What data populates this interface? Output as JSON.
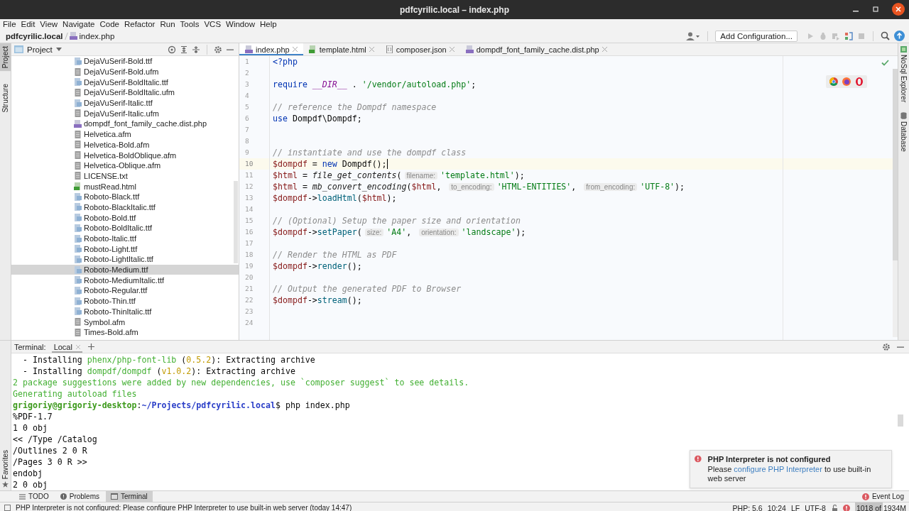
{
  "window": {
    "title": "pdfcyrilic.local – index.php"
  },
  "menu": [
    "File",
    "Edit",
    "View",
    "Navigate",
    "Code",
    "Refactor",
    "Run",
    "Tools",
    "VCS",
    "Window",
    "Help"
  ],
  "breadcrumb": [
    {
      "label": "pdfcyrilic.local",
      "kind": "project"
    },
    {
      "label": "index.php",
      "kind": "php"
    }
  ],
  "toolbar": {
    "run_config": "Add Configuration..."
  },
  "left_tool_tabs": [
    {
      "label": "Project",
      "selected": true
    },
    {
      "label": "Structure",
      "selected": false
    }
  ],
  "favorites": "Favorites",
  "right_tool_tabs": [
    {
      "label": "NoSql Explorer",
      "kind": "nosql"
    },
    {
      "label": "Database",
      "kind": "database"
    }
  ],
  "project_panel": {
    "title": "Project",
    "items": [
      {
        "name": "DejaVuSerif-Bold.ttf",
        "kind": "font",
        "selected": false
      },
      {
        "name": "DejaVuSerif-Bold.ufm",
        "kind": "doc",
        "selected": false
      },
      {
        "name": "DejaVuSerif-BoldItalic.ttf",
        "kind": "font",
        "selected": false
      },
      {
        "name": "DejaVuSerif-BoldItalic.ufm",
        "kind": "doc",
        "selected": false
      },
      {
        "name": "DejaVuSerif-Italic.ttf",
        "kind": "font",
        "selected": false
      },
      {
        "name": "DejaVuSerif-Italic.ufm",
        "kind": "doc",
        "selected": false
      },
      {
        "name": "dompdf_font_family_cache.dist.php",
        "kind": "php",
        "selected": false
      },
      {
        "name": "Helvetica.afm",
        "kind": "doc",
        "selected": false
      },
      {
        "name": "Helvetica-Bold.afm",
        "kind": "doc",
        "selected": false
      },
      {
        "name": "Helvetica-BoldOblique.afm",
        "kind": "doc",
        "selected": false
      },
      {
        "name": "Helvetica-Oblique.afm",
        "kind": "doc",
        "selected": false
      },
      {
        "name": "LICENSE.txt",
        "kind": "doc",
        "selected": false
      },
      {
        "name": "mustRead.html",
        "kind": "html",
        "selected": false
      },
      {
        "name": "Roboto-Black.ttf",
        "kind": "font",
        "selected": false
      },
      {
        "name": "Roboto-BlackItalic.ttf",
        "kind": "font",
        "selected": false
      },
      {
        "name": "Roboto-Bold.ttf",
        "kind": "font",
        "selected": false
      },
      {
        "name": "Roboto-BoldItalic.ttf",
        "kind": "font",
        "selected": false
      },
      {
        "name": "Roboto-Italic.ttf",
        "kind": "font",
        "selected": false
      },
      {
        "name": "Roboto-Light.ttf",
        "kind": "font",
        "selected": false
      },
      {
        "name": "Roboto-LightItalic.ttf",
        "kind": "font",
        "selected": false
      },
      {
        "name": "Roboto-Medium.ttf",
        "kind": "font",
        "selected": true
      },
      {
        "name": "Roboto-MediumItalic.ttf",
        "kind": "font",
        "selected": false
      },
      {
        "name": "Roboto-Regular.ttf",
        "kind": "font",
        "selected": false
      },
      {
        "name": "Roboto-Thin.ttf",
        "kind": "font",
        "selected": false
      },
      {
        "name": "Roboto-ThinItalic.ttf",
        "kind": "font",
        "selected": false
      },
      {
        "name": "Symbol.afm",
        "kind": "doc",
        "selected": false
      },
      {
        "name": "Times-Bold.afm",
        "kind": "doc",
        "selected": false
      }
    ]
  },
  "editor": {
    "tabs": [
      {
        "label": "index.php",
        "kind": "php",
        "selected": true
      },
      {
        "label": "template.html",
        "kind": "html",
        "selected": false
      },
      {
        "label": "composer.json",
        "kind": "json",
        "selected": false
      },
      {
        "label": "dompdf_font_family_cache.dist.php",
        "kind": "php",
        "selected": false
      }
    ],
    "lines": [
      {
        "number": "1",
        "current": false,
        "tokens": [
          {
            "kind": "keyword",
            "text": "<?php"
          }
        ]
      },
      {
        "number": "2",
        "current": false
      },
      {
        "number": "3",
        "current": false,
        "tokens": [
          {
            "kind": "keyword",
            "text": "require "
          },
          {
            "kind": "const",
            "text": "__DIR__"
          },
          {
            "kind": "plain",
            "text": " . "
          },
          {
            "kind": "string",
            "text": "'/vendor/autoload.php'"
          },
          {
            "kind": "plain",
            "text": ";"
          }
        ]
      },
      {
        "number": "4",
        "current": false
      },
      {
        "number": "5",
        "current": false,
        "tokens": [
          {
            "kind": "comment",
            "text": "// reference the Dompdf namespace"
          }
        ]
      },
      {
        "number": "6",
        "current": false,
        "tokens": [
          {
            "kind": "keyword",
            "text": "use"
          },
          {
            "kind": "plain",
            "text": " Dompdf\\Dompdf;"
          }
        ]
      },
      {
        "number": "7",
        "current": false
      },
      {
        "number": "8",
        "current": false
      },
      {
        "number": "9",
        "current": false,
        "tokens": [
          {
            "kind": "comment",
            "text": "// instantiate and use the dompdf class"
          }
        ]
      },
      {
        "number": "10",
        "current": true,
        "tokens": [
          {
            "kind": "var",
            "text": "$dompdf"
          },
          {
            "kind": "plain",
            "text": " = "
          },
          {
            "kind": "keyword",
            "text": "new"
          },
          {
            "kind": "plain",
            "text": " Dompdf();"
          }
        ]
      },
      {
        "number": "11",
        "current": false,
        "tokens": [
          {
            "kind": "var",
            "text": "$html"
          },
          {
            "kind": "plain",
            "text": " = "
          },
          {
            "kind": "function",
            "text": "file_get_contents"
          },
          {
            "kind": "plain",
            "text": "("
          },
          {
            "kind": "hint",
            "text": "filename:"
          },
          {
            "kind": "string",
            "text": "'template.html'"
          },
          {
            "kind": "plain",
            "text": ");"
          }
        ]
      },
      {
        "number": "12",
        "current": false,
        "tokens": [
          {
            "kind": "var",
            "text": "$html"
          },
          {
            "kind": "plain",
            "text": " = "
          },
          {
            "kind": "function",
            "text": "mb_convert_encoding"
          },
          {
            "kind": "plain",
            "text": "("
          },
          {
            "kind": "var",
            "text": "$html"
          },
          {
            "kind": "plain",
            "text": ", "
          },
          {
            "kind": "hint",
            "text": "to_encoding:"
          },
          {
            "kind": "string",
            "text": "'HTML-ENTITIES'"
          },
          {
            "kind": "plain",
            "text": ", "
          },
          {
            "kind": "hint",
            "text": "from_encoding:"
          },
          {
            "kind": "string",
            "text": "'UTF-8'"
          },
          {
            "kind": "plain",
            "text": ");"
          }
        ]
      },
      {
        "number": "13",
        "current": false,
        "tokens": [
          {
            "kind": "var",
            "text": "$dompdf"
          },
          {
            "kind": "plain",
            "text": "->"
          },
          {
            "kind": "method",
            "text": "loadHtml"
          },
          {
            "kind": "plain",
            "text": "("
          },
          {
            "kind": "var",
            "text": "$html"
          },
          {
            "kind": "plain",
            "text": ");"
          }
        ]
      },
      {
        "number": "14",
        "current": false
      },
      {
        "number": "15",
        "current": false,
        "tokens": [
          {
            "kind": "comment",
            "text": "// (Optional) Setup the paper size and orientation"
          }
        ]
      },
      {
        "number": "16",
        "current": false,
        "tokens": [
          {
            "kind": "var",
            "text": "$dompdf"
          },
          {
            "kind": "plain",
            "text": "->"
          },
          {
            "kind": "method",
            "text": "setPaper"
          },
          {
            "kind": "plain",
            "text": "("
          },
          {
            "kind": "hint",
            "text": "size:"
          },
          {
            "kind": "string",
            "text": "'A4'"
          },
          {
            "kind": "plain",
            "text": ", "
          },
          {
            "kind": "hint",
            "text": "orientation:"
          },
          {
            "kind": "string",
            "text": "'landscape'"
          },
          {
            "kind": "plain",
            "text": ");"
          }
        ]
      },
      {
        "number": "17",
        "current": false
      },
      {
        "number": "18",
        "current": false,
        "tokens": [
          {
            "kind": "comment",
            "text": "// Render the HTML as PDF"
          }
        ]
      },
      {
        "number": "19",
        "current": false,
        "tokens": [
          {
            "kind": "var",
            "text": "$dompdf"
          },
          {
            "kind": "plain",
            "text": "->"
          },
          {
            "kind": "method",
            "text": "render"
          },
          {
            "kind": "plain",
            "text": "();"
          }
        ]
      },
      {
        "number": "20",
        "current": false
      },
      {
        "number": "21",
        "current": false,
        "tokens": [
          {
            "kind": "comment",
            "text": "// Output the generated PDF to Browser"
          }
        ]
      },
      {
        "number": "22",
        "current": false,
        "tokens": [
          {
            "kind": "var",
            "text": "$dompdf"
          },
          {
            "kind": "plain",
            "text": "->"
          },
          {
            "kind": "method",
            "text": "stream"
          },
          {
            "kind": "plain",
            "text": "();"
          }
        ]
      },
      {
        "number": "23",
        "current": false
      },
      {
        "number": "24",
        "current": false
      }
    ]
  },
  "terminal": {
    "title": "Terminal:",
    "tabs": [
      {
        "label": "Local",
        "selected": true
      }
    ],
    "lines": [
      [
        {
          "kind": "plain",
          "text": "  - Installing "
        },
        {
          "kind": "green",
          "text": "phenx/php-font-lib"
        },
        {
          "kind": "plain",
          "text": " ("
        },
        {
          "kind": "version",
          "text": "0.5.2"
        },
        {
          "kind": "plain",
          "text": "): Extracting archive"
        }
      ],
      [
        {
          "kind": "plain",
          "text": "  - Installing "
        },
        {
          "kind": "green",
          "text": "dompdf/dompdf"
        },
        {
          "kind": "plain",
          "text": " ("
        },
        {
          "kind": "version",
          "text": "v1.0.2"
        },
        {
          "kind": "plain",
          "text": "): Extracting archive"
        }
      ],
      [
        {
          "kind": "green",
          "text": "2 package suggestions were added by new dependencies, use `composer suggest` to see details."
        }
      ],
      [
        {
          "kind": "green",
          "text": "Generating autoload files"
        }
      ],
      [
        {
          "kind": "user",
          "text": "grigoriy@grigoriy-desktop"
        },
        {
          "kind": "plain",
          "text": ":"
        },
        {
          "kind": "path",
          "text": "~/Projects/pdfcyrilic.local"
        },
        {
          "kind": "plain",
          "text": "$ php index.php"
        }
      ],
      [
        {
          "kind": "plain",
          "text": "%PDF-1.7"
        }
      ],
      [
        {
          "kind": "plain",
          "text": "1 0 obj"
        }
      ],
      [
        {
          "kind": "plain",
          "text": "<< /Type /Catalog"
        }
      ],
      [
        {
          "kind": "plain",
          "text": "/Outlines 2 0 R"
        }
      ],
      [
        {
          "kind": "plain",
          "text": "/Pages 3 0 R >>"
        }
      ],
      [
        {
          "kind": "plain",
          "text": "endobj"
        }
      ],
      [
        {
          "kind": "plain",
          "text": "2 0 obj"
        }
      ]
    ]
  },
  "notification": {
    "title": "PHP Interpreter is not configured",
    "text_before": "Please ",
    "link": "configure PHP Interpreter",
    "text_after": " to use built-in web server"
  },
  "bottom_tabs": [
    {
      "label": "TODO",
      "kind": "todo",
      "selected": false
    },
    {
      "label": "Problems",
      "kind": "problems",
      "selected": false
    },
    {
      "label": "Terminal",
      "kind": "terminal",
      "selected": true
    }
  ],
  "event_log": "Event Log",
  "status_bar": {
    "message": "PHP Interpreter is not configured: Please configure PHP Interpreter to use built-in web server (today 14:47)",
    "php": "PHP: 5.6",
    "position": "10:24",
    "line_ending": "LF",
    "encoding": "UTF-8",
    "memory": {
      "text": "1018 of 1934M",
      "level": 0.53
    }
  }
}
